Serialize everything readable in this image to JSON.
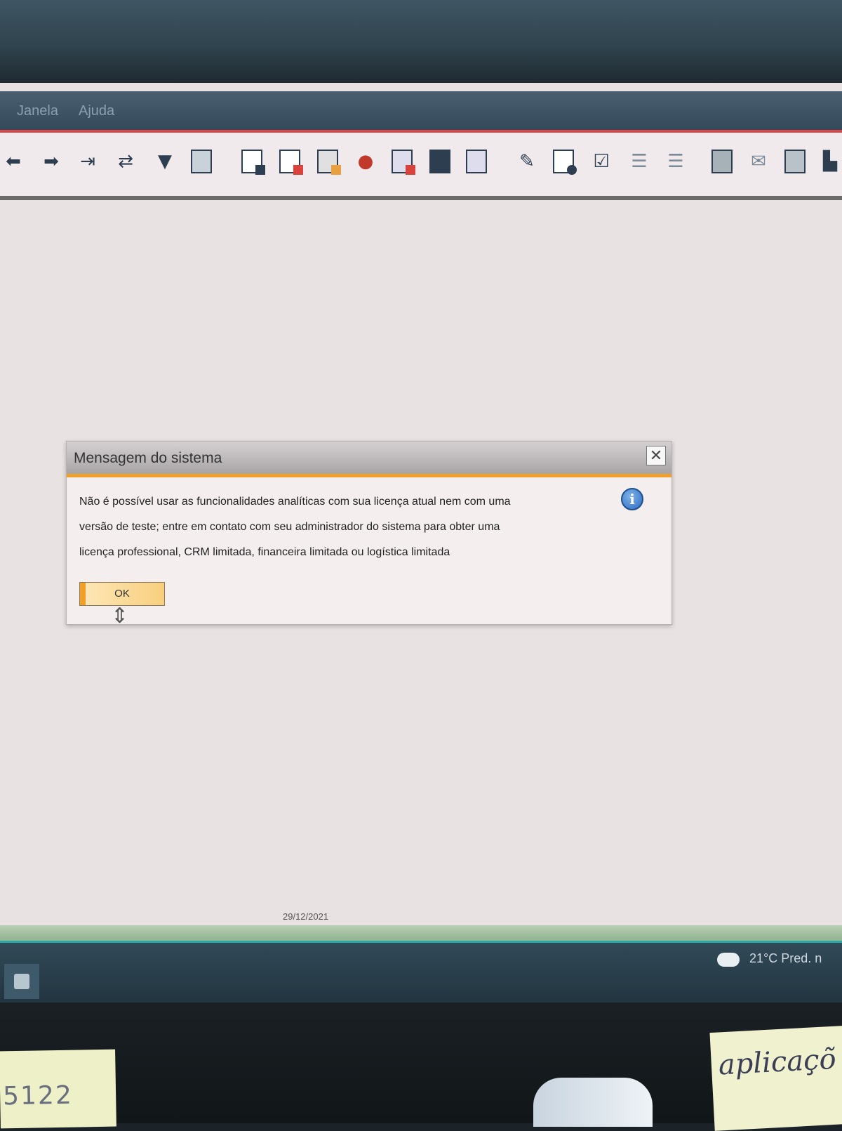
{
  "menu": {
    "items": [
      "Janela",
      "Ajuda"
    ]
  },
  "toolbar": {
    "icons": [
      "arrow-left-icon",
      "arrow-right-icon",
      "arrow-last-icon",
      "refresh-icon",
      "filter-icon",
      "sort-icon",
      "doc-icon-1",
      "doc-icon-2",
      "calculator-icon",
      "users-icon",
      "chart-icon",
      "doc-icon-3",
      "settings-doc-icon",
      "sign-icon",
      "doc-gear-icon",
      "check-edit-icon",
      "message-icon-1",
      "message-icon-2",
      "calendar-icon",
      "mail-icon",
      "report-icon",
      "group-icon"
    ]
  },
  "dialog": {
    "title": "Mensagem do sistema",
    "close_label": "✕",
    "message_line1": "Não é possível usar as funcionalidades analíticas com sua licença atual nem com uma",
    "message_line2": "versão de teste; entre em contato com seu administrador do sistema para obter uma",
    "message_line3": "licença professional, CRM limitada, financeira limitada ou logística limitada",
    "info_label": "i",
    "ok_label": "OK"
  },
  "status": {
    "date": "29/12/2021"
  },
  "taskbar": {
    "weather": "21°C  Pred. n"
  },
  "desk": {
    "sticky_left": "5122",
    "sticky_right": "aplicaçõ"
  },
  "colors": {
    "accent": "#f0a028",
    "menubar_border": "#d8484a",
    "status_green": "#8fb38e"
  }
}
